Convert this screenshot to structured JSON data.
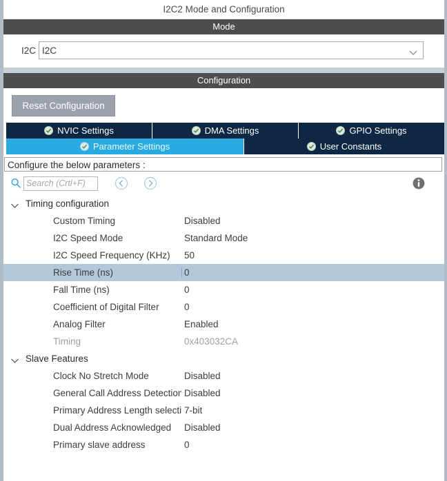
{
  "panel": {
    "title": "I2C2 Mode and Configuration"
  },
  "mode_section": {
    "header": "Mode",
    "field_label": "I2C",
    "combo_value": "I2C",
    "caret_icon": "chevron-down-icon"
  },
  "configuration_section": {
    "header": "Configuration",
    "reset_button": "Reset Configuration"
  },
  "tabs": {
    "row1": [
      {
        "label": "NVIC Settings",
        "active": false,
        "icon": "check-circle-icon"
      },
      {
        "label": "DMA Settings",
        "active": false,
        "icon": "check-circle-icon"
      },
      {
        "label": "GPIO Settings",
        "active": false,
        "icon": "check-circle-icon"
      }
    ],
    "row2": [
      {
        "label": "Parameter Settings",
        "active": true,
        "icon": "check-circle-icon"
      },
      {
        "label": "User Constants",
        "active": false,
        "icon": "check-circle-icon"
      }
    ]
  },
  "configure_note": "Configure the below parameters :",
  "search": {
    "icon": "search-icon",
    "value": "",
    "placeholder": "Search (Crtl+F)",
    "prev_icon": "chevron-left-circle-icon",
    "next_icon": "chevron-right-circle-icon",
    "info_icon": "info-circle-icon"
  },
  "groups": [
    {
      "title": "Timing configuration",
      "expanded": true,
      "chevron_icon": "chevron-down-icon",
      "rows": [
        {
          "name": "Custom Timing",
          "value": "Disabled",
          "selected": false,
          "dim": false
        },
        {
          "name": "I2C Speed Mode",
          "value": "Standard Mode",
          "selected": false,
          "dim": false
        },
        {
          "name": "I2C Speed Frequency (KHz)",
          "value": "50",
          "selected": false,
          "dim": false
        },
        {
          "name": "Rise Time (ns)",
          "value": "0",
          "selected": true,
          "dim": false
        },
        {
          "name": "Fall Time (ns)",
          "value": "0",
          "selected": false,
          "dim": false
        },
        {
          "name": "Coefficient of Digital Filter",
          "value": "0",
          "selected": false,
          "dim": false
        },
        {
          "name": "Analog Filter",
          "value": "Enabled",
          "selected": false,
          "dim": false
        },
        {
          "name": "Timing",
          "value": "0x403032CA",
          "selected": false,
          "dim": true
        }
      ]
    },
    {
      "title": "Slave Features",
      "expanded": true,
      "chevron_icon": "chevron-down-icon",
      "rows": [
        {
          "name": "Clock No Stretch Mode",
          "value": "Disabled",
          "selected": false,
          "dim": false
        },
        {
          "name": "General Call Address Detection",
          "value": "Disabled",
          "selected": false,
          "dim": false
        },
        {
          "name": "Primary Address Length selection",
          "value": "7-bit",
          "selected": false,
          "dim": false
        },
        {
          "name": "Dual Address Acknowledged",
          "value": "Disabled",
          "selected": false,
          "dim": false
        },
        {
          "name": "Primary slave address",
          "value": "0",
          "selected": false,
          "dim": false
        }
      ]
    }
  ],
  "colors": {
    "section_bar": "#4d4d4d",
    "tab_inactive": "#0d2744",
    "tab_active": "#29abe2",
    "selection": "#b4c8dc",
    "rail": "#b0bcc8",
    "reset_button": "#9ba2ab",
    "accent_cyan": "#29abe2"
  }
}
